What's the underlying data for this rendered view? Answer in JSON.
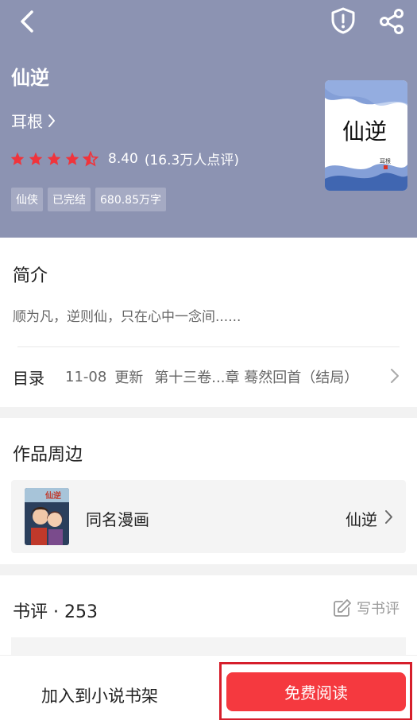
{
  "book": {
    "title": "仙逆",
    "author": "耳根",
    "rating_score": "8.40",
    "rating_count": "(16.3万人点评)",
    "stars_full": 4.5,
    "tags": [
      "仙侠",
      "已完结",
      "680.85万字"
    ],
    "cover_title": "仙逆",
    "cover_author": "耳根"
  },
  "icons": {
    "back": "chevron-left-icon",
    "shield": "shield-alert-icon",
    "share": "share-icon",
    "star": "star-icon",
    "edit": "edit-icon"
  },
  "intro": {
    "heading": "简介",
    "text": "顺为凡，逆则仙，只在心中一念间......"
  },
  "toc": {
    "label": "目录",
    "date": "11-08",
    "update": "更新",
    "chapter": "第十三卷...章 蓦然回首（结局）"
  },
  "related": {
    "heading": "作品周边",
    "item_label": "同名漫画",
    "item_name": "仙逆"
  },
  "reviews": {
    "heading": "书评 · 253",
    "write": "写书评"
  },
  "bottom": {
    "add_shelf": "加入到小说书架",
    "read": "免费阅读"
  },
  "colors": {
    "header_bg": "#8c93b2",
    "accent_red": "#f5393f",
    "star_red": "#f0343c"
  }
}
